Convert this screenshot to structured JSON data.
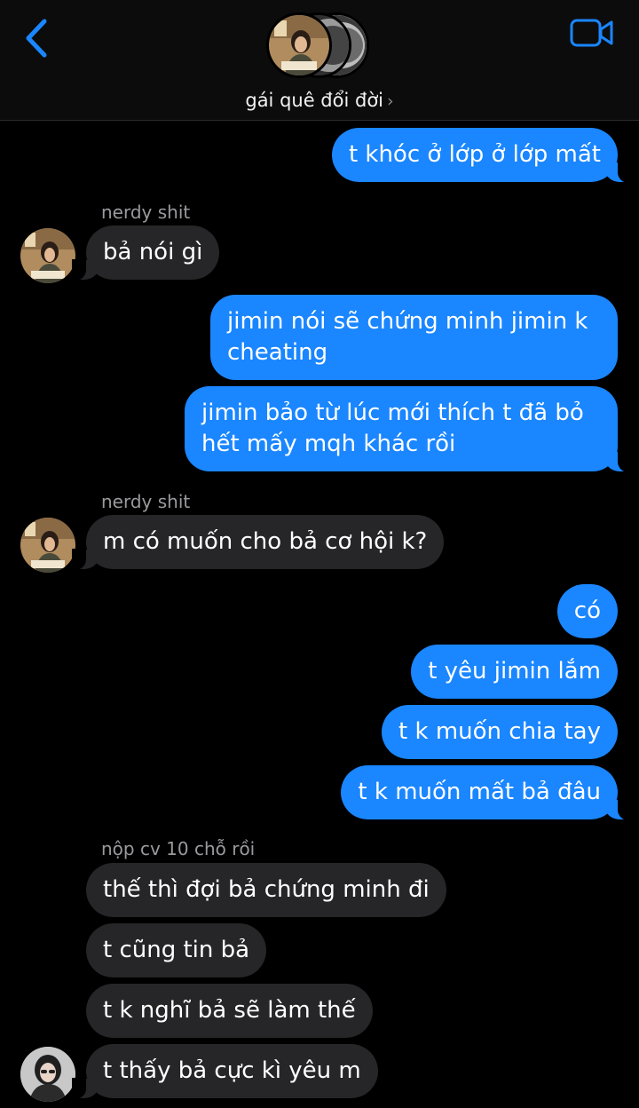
{
  "header": {
    "title": "gái quê đổi đời",
    "title_chevron": "›",
    "back_icon": "chevron-left-icon",
    "video_icon": "video-camera-icon"
  },
  "colors": {
    "outgoing_bubble": "#1a86ff",
    "incoming_bubble": "#262628",
    "accent": "#1a86ff",
    "background": "#000000"
  },
  "messages": [
    {
      "dir": "out",
      "text": "t khóc ở lớp ở lớp mất"
    },
    {
      "dir": "in",
      "sender": "nerdy shit",
      "text": "bả nói gì"
    },
    {
      "dir": "out",
      "text": "jimin nói sẽ chứng minh jimin k cheating"
    },
    {
      "dir": "out",
      "text": "jimin bảo từ lúc mới thích t đã bỏ hết mấy mqh khác rồi"
    },
    {
      "dir": "in",
      "sender": "nerdy shit",
      "text": "m có muốn cho bả cơ hội k?"
    },
    {
      "dir": "out",
      "text": "có"
    },
    {
      "dir": "out",
      "text": "t yêu jimin lắm"
    },
    {
      "dir": "out",
      "text": "t k muốn chia tay"
    },
    {
      "dir": "out",
      "text": "t k muốn mất bả đâu"
    },
    {
      "dir": "in",
      "sender": "nộp cv 10 chỗ rồi",
      "text": "thế thì đợi bả chứng minh đi"
    },
    {
      "dir": "in",
      "text": "t cũng tin bả"
    },
    {
      "dir": "in",
      "text": "t k nghĩ bả sẽ làm thế"
    },
    {
      "dir": "in",
      "text": "t thấy bả cực kì yêu m"
    }
  ]
}
